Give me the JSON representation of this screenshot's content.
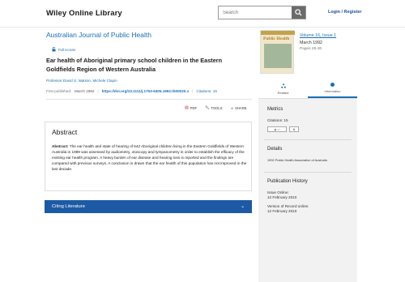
{
  "header": {
    "logo": "Wiley Online Library",
    "search_placeholder": "Search",
    "login": "Login / Register"
  },
  "article": {
    "journal": "Australian Journal of Public Health",
    "access": "Full Access",
    "title": "Ear health of Aboriginal primary school children in the Eastern Goldfields Region of Western Australia",
    "authors": "Professor David S. Watson,  Michele Clapin",
    "first_published_label": "First published:",
    "first_published": "March 1992",
    "doi": "https://doi.org/10.1111/j.1753-6405.1992.tb00020.x",
    "citations": "Citations: 15"
  },
  "tools": {
    "pdf": "PDF",
    "tools": "TOOLS",
    "share": "SHARE"
  },
  "abstract": {
    "heading": "Abstract",
    "label": "Abstract:",
    "text": " The ear health and state of hearing of 642 Aboriginal children living in the Eastern Goldfields of Western Australia in 1989 was assessed by audiometry, otoscopy and tympanometry in order to establish the efficacy of the existing ear health program. A heavy burden of ear disease and hearing loss is reported and the findings are compared with previous surveys. A conclusion is drawn that the ear health of this population has not improved in the last decade."
  },
  "citing": {
    "label": "Citing Literature"
  },
  "issue": {
    "cover_title": "Public Health",
    "volume": "Volume 16, Issue 1",
    "date": "March 1992",
    "pages": "Pages 25-30"
  },
  "side_tabs": [
    {
      "label": "Related"
    },
    {
      "label": "Information"
    }
  ],
  "metrics": {
    "heading": "Metrics",
    "citations": "Citations: 15",
    "badge_count": "6"
  },
  "details": {
    "heading": "Details",
    "text": "1992 Public Health Association of Australia"
  },
  "history": {
    "heading": "Publication History",
    "issue_online_label": "Issue Online:",
    "issue_online": "12 February 2010",
    "vor_label": "Version of Record online:",
    "vor": "12 February 2010"
  },
  "colors": {
    "link": "#1a6fb5",
    "citing_bar": "#1c5aa5"
  }
}
